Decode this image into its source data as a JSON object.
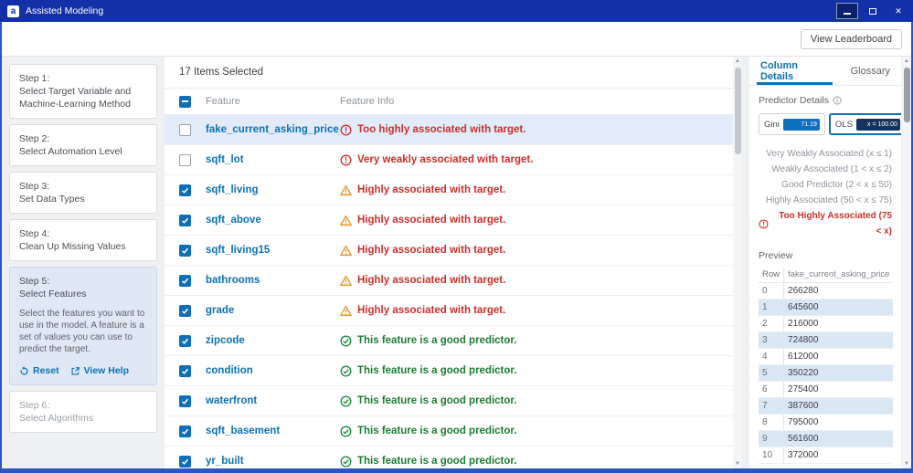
{
  "window": {
    "title": "Assisted Modeling",
    "logo_letter": "a"
  },
  "toolbar": {
    "view_leaderboard_label": "View Leaderboard"
  },
  "steps": [
    {
      "label": "Step 1:",
      "name": "Select Target Variable and Machine-Learning Method"
    },
    {
      "label": "Step 2:",
      "name": "Select Automation Level"
    },
    {
      "label": "Step 3:",
      "name": "Set Data Types"
    },
    {
      "label": "Step 4:",
      "name": "Clean Up Missing Values"
    },
    {
      "label": "Step 5:",
      "name": "Select Features",
      "description": "Select the features you want to use in the model. A feature is a set of values you can use to predict the target.",
      "reset_label": "Reset",
      "view_help_label": "View Help"
    },
    {
      "label": "Step 6:",
      "name": "Select Algorithms"
    }
  ],
  "feature_table": {
    "selected_count": "17 Items Selected",
    "columns": {
      "feature": "Feature",
      "feature_info": "Feature Info"
    },
    "rows": [
      {
        "feature": "fake_current_asking_price",
        "checked": false,
        "selected": true,
        "status": "error",
        "info": "Too highly associated with target."
      },
      {
        "feature": "sqft_lot",
        "checked": false,
        "selected": false,
        "status": "error",
        "info": "Very weakly associated with target."
      },
      {
        "feature": "sqft_living",
        "checked": true,
        "selected": false,
        "status": "warning",
        "info": "Highly associated with target."
      },
      {
        "feature": "sqft_above",
        "checked": true,
        "selected": false,
        "status": "warning",
        "info": "Highly associated with target."
      },
      {
        "feature": "sqft_living15",
        "checked": true,
        "selected": false,
        "status": "warning",
        "info": "Highly associated with target."
      },
      {
        "feature": "bathrooms",
        "checked": true,
        "selected": false,
        "status": "warning",
        "info": "Highly associated with target."
      },
      {
        "feature": "grade",
        "checked": true,
        "selected": false,
        "status": "warning",
        "info": "Highly associated with target."
      },
      {
        "feature": "zipcode",
        "checked": true,
        "selected": false,
        "status": "good",
        "info": "This feature is a good predictor."
      },
      {
        "feature": "condition",
        "checked": true,
        "selected": false,
        "status": "good",
        "info": "This feature is a good predictor."
      },
      {
        "feature": "waterfront",
        "checked": true,
        "selected": false,
        "status": "good",
        "info": "This feature is a good predictor."
      },
      {
        "feature": "sqft_basement",
        "checked": true,
        "selected": false,
        "status": "good",
        "info": "This feature is a good predictor."
      },
      {
        "feature": "yr_built",
        "checked": true,
        "selected": false,
        "status": "good",
        "info": "This feature is a good predictor."
      }
    ]
  },
  "right_panel": {
    "tabs": {
      "column_details": "Column Details",
      "glossary": "Glossary"
    },
    "active_tab": "Column Details",
    "predictor_details": {
      "title": "Predictor Details",
      "gini": {
        "label": "Gini",
        "value": "71.19"
      },
      "ols": {
        "label": "OLS",
        "value": "x = 100.00",
        "selected": true
      },
      "legend": [
        {
          "label": "Very Weakly Associated (x ≤ 1)"
        },
        {
          "label": "Weakly Associated (1 < x ≤ 2)"
        },
        {
          "label": "Good Predictor (2 < x ≤ 50)"
        },
        {
          "label": "Highly Associated (50 < x ≤ 75)"
        },
        {
          "label": "Too Highly Associated (75 < x)",
          "status": "error"
        }
      ]
    },
    "preview": {
      "title": "Preview",
      "columns": {
        "row": "Row",
        "value": "fake_current_asking_price"
      },
      "rows": [
        [
          "0",
          "266280"
        ],
        [
          "1",
          "645600"
        ],
        [
          "2",
          "216000"
        ],
        [
          "3",
          "724800"
        ],
        [
          "4",
          "612000"
        ],
        [
          "5",
          "350220"
        ],
        [
          "6",
          "275400"
        ],
        [
          "7",
          "387600"
        ],
        [
          "8",
          "795000"
        ],
        [
          "9",
          "561600"
        ],
        [
          "10",
          "372000"
        ]
      ]
    }
  },
  "colors": {
    "titlebar": "#1330a7",
    "accent_blue": "#0b72b5",
    "error_red": "#c9302c",
    "warning_orange": "#e59a2f",
    "good_green": "#1c7c33"
  }
}
